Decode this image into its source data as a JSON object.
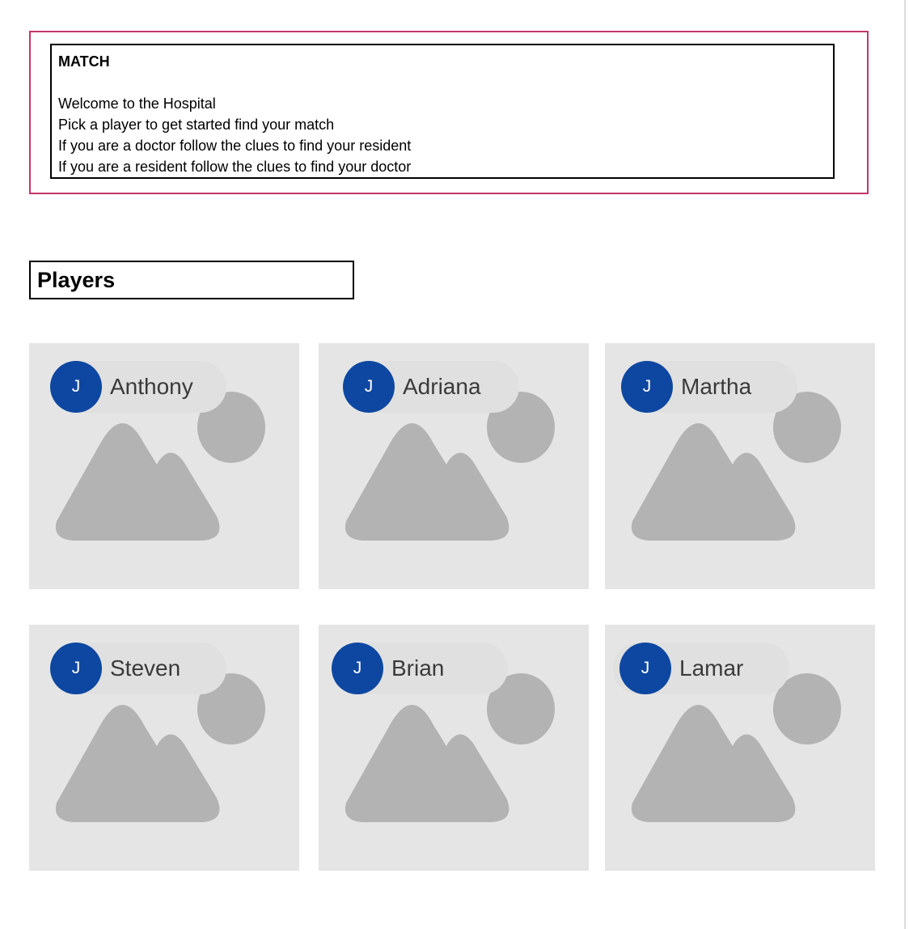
{
  "intro": {
    "title": "MATCH",
    "lines": [
      "Welcome to the Hospital",
      "Pick a player to get started find your match",
      "If you are a doctor follow the clues to find your resident",
      "If you are a resident follow the clues to find your doctor"
    ]
  },
  "players_heading": "Players",
  "players": [
    {
      "initial": "J",
      "name": "Anthony",
      "image_icon": "image-placeholder-icon"
    },
    {
      "initial": "J",
      "name": "Adriana",
      "image_icon": "image-placeholder-icon"
    },
    {
      "initial": "J",
      "name": "Martha",
      "image_icon": "image-placeholder-icon"
    },
    {
      "initial": "J",
      "name": "Steven",
      "image_icon": "image-placeholder-icon"
    },
    {
      "initial": "J",
      "name": "Brian",
      "image_icon": "image-placeholder-icon"
    },
    {
      "initial": "J",
      "name": "Lamar",
      "image_icon": "image-placeholder-icon"
    }
  ],
  "colors": {
    "intro_border": "#c2366b",
    "avatar_bg": "#0d47a1",
    "card_bg": "#e5e5e5",
    "placeholder": "#b3b3b3",
    "chip_bg": "#e0e0e0"
  }
}
